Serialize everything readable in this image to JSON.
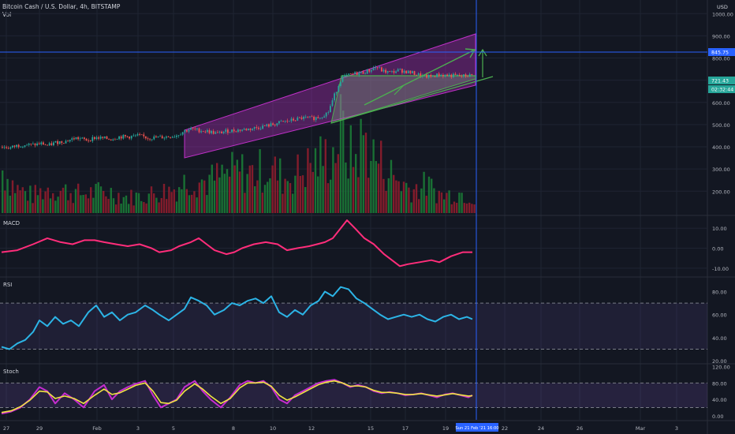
{
  "header": {
    "title": "Bitcoin Cash / U.S. Dollar, 4h, BITSTAMP",
    "volume_label": "Vol",
    "currency": "USD"
  },
  "price_axis": {
    "ticks": [
      "1000.00",
      "900.00",
      "800.00",
      "700.00",
      "600.00",
      "500.00",
      "400.00",
      "300.00",
      "200.00"
    ],
    "badges": [
      {
        "text": "845.75",
        "color": "#2962ff"
      },
      {
        "text": "721.43",
        "color": "#26a69a"
      },
      {
        "text": "02:32:44",
        "color": "#26a69a"
      }
    ]
  },
  "x_axis": {
    "ticks": [
      "27",
      "29",
      "Feb",
      "3",
      "5",
      "8",
      "10",
      "12",
      "15",
      "17",
      "19",
      "22",
      "24",
      "26",
      "Mar",
      "3"
    ],
    "crosshair_badge": "Sun 21 Feb '21  16:00"
  },
  "panes": {
    "macd": {
      "label": "MACD",
      "ticks": [
        "10.00",
        "0.00",
        "-10.00"
      ]
    },
    "rsi": {
      "label": "RSI",
      "ticks": [
        "80.00",
        "60.00",
        "40.00",
        "20.00"
      ]
    },
    "stoch": {
      "label": "Stoch",
      "ticks": [
        "120.00",
        "80.00",
        "40.00",
        "0.00"
      ]
    }
  },
  "colors": {
    "background": "#131722",
    "grid": "#1f2433",
    "up": "#26a69a",
    "down": "#ef5350",
    "vol_up": "#1b7a36",
    "vol_down": "#8f1d2c",
    "channel": "#c030c8",
    "wedge": "#4caf50",
    "crosshair": "#2962ff",
    "macd": "#ff2d7a",
    "rsi": "#2cb4e6",
    "stoch_k": "#c62dcf",
    "stoch_d": "#f0e442"
  },
  "chart_data": {
    "type": "line",
    "title": "Bitcoin Cash / U.S. Dollar, 4h, BITSTAMP",
    "price_range": [
      130,
      1040
    ],
    "price_path": [
      [
        0,
        400
      ],
      [
        12,
        395
      ],
      [
        20,
        405
      ],
      [
        30,
        410
      ],
      [
        40,
        408
      ],
      [
        52,
        415
      ],
      [
        60,
        405
      ],
      [
        70,
        420
      ],
      [
        82,
        425
      ],
      [
        95,
        440
      ],
      [
        110,
        430
      ],
      [
        120,
        442
      ],
      [
        130,
        438
      ],
      [
        140,
        435
      ],
      [
        150,
        445
      ],
      [
        162,
        445
      ],
      [
        175,
        450
      ],
      [
        187,
        440
      ],
      [
        200,
        442
      ],
      [
        210,
        445
      ],
      [
        222,
        450
      ],
      [
        232,
        470
      ],
      [
        240,
        480
      ],
      [
        250,
        475
      ],
      [
        262,
        470
      ],
      [
        275,
        460
      ],
      [
        285,
        470
      ],
      [
        300,
        475
      ],
      [
        315,
        480
      ],
      [
        330,
        490
      ],
      [
        345,
        500
      ],
      [
        355,
        510
      ],
      [
        370,
        520
      ],
      [
        382,
        530
      ],
      [
        395,
        528
      ],
      [
        405,
        535
      ],
      [
        415,
        555
      ],
      [
        424,
        640
      ],
      [
        432,
        710
      ],
      [
        440,
        720
      ],
      [
        450,
        730
      ],
      [
        460,
        735
      ],
      [
        468,
        745
      ],
      [
        476,
        760
      ],
      [
        485,
        740
      ],
      [
        495,
        735
      ],
      [
        505,
        745
      ],
      [
        515,
        738
      ],
      [
        525,
        730
      ],
      [
        535,
        718
      ],
      [
        545,
        715
      ],
      [
        555,
        725
      ],
      [
        565,
        722
      ],
      [
        575,
        720
      ],
      [
        585,
        718
      ],
      [
        595,
        722
      ],
      [
        600,
        721
      ]
    ],
    "volume_path": [
      [
        0,
        260
      ],
      [
        20,
        200
      ],
      [
        40,
        180
      ],
      [
        60,
        200
      ],
      [
        80,
        195
      ],
      [
        100,
        185
      ],
      [
        120,
        190
      ],
      [
        140,
        190
      ],
      [
        160,
        175
      ],
      [
        180,
        180
      ],
      [
        200,
        190
      ],
      [
        220,
        200
      ],
      [
        240,
        230
      ],
      [
        260,
        220
      ],
      [
        280,
        235
      ],
      [
        300,
        250
      ],
      [
        320,
        245
      ],
      [
        340,
        260
      ],
      [
        360,
        230
      ],
      [
        380,
        250
      ],
      [
        400,
        280
      ],
      [
        420,
        295
      ],
      [
        432,
        370
      ],
      [
        440,
        300
      ],
      [
        450,
        290
      ],
      [
        460,
        350
      ],
      [
        470,
        300
      ],
      [
        480,
        280
      ],
      [
        500,
        230
      ],
      [
        520,
        200
      ],
      [
        540,
        210
      ],
      [
        560,
        180
      ],
      [
        580,
        190
      ],
      [
        600,
        175
      ]
    ],
    "macd_path": [
      [
        0,
        -2
      ],
      [
        20,
        -1
      ],
      [
        40,
        2
      ],
      [
        58,
        5
      ],
      [
        75,
        3
      ],
      [
        90,
        2
      ],
      [
        105,
        4
      ],
      [
        118,
        4
      ],
      [
        130,
        3
      ],
      [
        145,
        2
      ],
      [
        160,
        1
      ],
      [
        175,
        2
      ],
      [
        190,
        0
      ],
      [
        200,
        -2
      ],
      [
        215,
        -1
      ],
      [
        225,
        1
      ],
      [
        240,
        3
      ],
      [
        250,
        5
      ],
      [
        260,
        2
      ],
      [
        270,
        -1
      ],
      [
        285,
        -3
      ],
      [
        295,
        -2
      ],
      [
        305,
        0
      ],
      [
        320,
        2
      ],
      [
        335,
        3
      ],
      [
        350,
        2
      ],
      [
        362,
        -1
      ],
      [
        375,
        0
      ],
      [
        390,
        1
      ],
      [
        400,
        2
      ],
      [
        410,
        3
      ],
      [
        420,
        5
      ],
      [
        430,
        10
      ],
      [
        438,
        14
      ],
      [
        448,
        10
      ],
      [
        460,
        5
      ],
      [
        472,
        2
      ],
      [
        485,
        -3
      ],
      [
        495,
        -6
      ],
      [
        505,
        -9
      ],
      [
        515,
        -8
      ],
      [
        530,
        -7
      ],
      [
        545,
        -6
      ],
      [
        555,
        -7
      ],
      [
        570,
        -4
      ],
      [
        585,
        -2
      ],
      [
        597,
        -2
      ]
    ],
    "macd_range": [
      -14,
      16
    ],
    "rsi_path": [
      [
        0,
        32
      ],
      [
        10,
        30
      ],
      [
        20,
        35
      ],
      [
        30,
        38
      ],
      [
        40,
        45
      ],
      [
        48,
        55
      ],
      [
        58,
        50
      ],
      [
        68,
        58
      ],
      [
        78,
        52
      ],
      [
        88,
        55
      ],
      [
        98,
        50
      ],
      [
        110,
        62
      ],
      [
        120,
        68
      ],
      [
        130,
        58
      ],
      [
        140,
        62
      ],
      [
        150,
        55
      ],
      [
        160,
        60
      ],
      [
        170,
        62
      ],
      [
        182,
        68
      ],
      [
        192,
        64
      ],
      [
        200,
        60
      ],
      [
        212,
        55
      ],
      [
        222,
        60
      ],
      [
        232,
        65
      ],
      [
        240,
        75
      ],
      [
        250,
        72
      ],
      [
        260,
        68
      ],
      [
        270,
        60
      ],
      [
        282,
        64
      ],
      [
        292,
        70
      ],
      [
        302,
        68
      ],
      [
        312,
        72
      ],
      [
        322,
        74
      ],
      [
        332,
        70
      ],
      [
        342,
        76
      ],
      [
        352,
        62
      ],
      [
        362,
        58
      ],
      [
        372,
        64
      ],
      [
        382,
        60
      ],
      [
        392,
        68
      ],
      [
        402,
        72
      ],
      [
        410,
        80
      ],
      [
        420,
        76
      ],
      [
        430,
        84
      ],
      [
        440,
        82
      ],
      [
        450,
        74
      ],
      [
        460,
        70
      ],
      [
        470,
        65
      ],
      [
        480,
        60
      ],
      [
        490,
        56
      ],
      [
        500,
        58
      ],
      [
        510,
        60
      ],
      [
        520,
        58
      ],
      [
        530,
        60
      ],
      [
        540,
        56
      ],
      [
        550,
        54
      ],
      [
        560,
        58
      ],
      [
        570,
        60
      ],
      [
        580,
        56
      ],
      [
        590,
        58
      ],
      [
        597,
        56
      ]
    ],
    "rsi_range": [
      18,
      92
    ],
    "stoch_k_path": [
      [
        0,
        5
      ],
      [
        12,
        10
      ],
      [
        24,
        20
      ],
      [
        36,
        40
      ],
      [
        48,
        70
      ],
      [
        58,
        60
      ],
      [
        68,
        30
      ],
      [
        80,
        55
      ],
      [
        92,
        40
      ],
      [
        104,
        20
      ],
      [
        118,
        60
      ],
      [
        130,
        75
      ],
      [
        140,
        40
      ],
      [
        150,
        60
      ],
      [
        160,
        70
      ],
      [
        170,
        78
      ],
      [
        182,
        85
      ],
      [
        192,
        50
      ],
      [
        202,
        20
      ],
      [
        212,
        30
      ],
      [
        222,
        40
      ],
      [
        232,
        70
      ],
      [
        245,
        85
      ],
      [
        255,
        60
      ],
      [
        265,
        40
      ],
      [
        278,
        20
      ],
      [
        290,
        45
      ],
      [
        302,
        75
      ],
      [
        312,
        85
      ],
      [
        322,
        80
      ],
      [
        332,
        85
      ],
      [
        342,
        70
      ],
      [
        352,
        40
      ],
      [
        362,
        30
      ],
      [
        372,
        50
      ],
      [
        382,
        60
      ],
      [
        392,
        70
      ],
      [
        402,
        80
      ],
      [
        412,
        85
      ],
      [
        422,
        88
      ],
      [
        432,
        80
      ],
      [
        442,
        70
      ],
      [
        452,
        75
      ],
      [
        462,
        70
      ],
      [
        472,
        60
      ],
      [
        482,
        55
      ],
      [
        492,
        58
      ],
      [
        502,
        55
      ],
      [
        512,
        50
      ],
      [
        522,
        52
      ],
      [
        532,
        55
      ],
      [
        542,
        50
      ],
      [
        552,
        45
      ],
      [
        562,
        52
      ],
      [
        572,
        55
      ],
      [
        582,
        50
      ],
      [
        592,
        45
      ],
      [
        597,
        50
      ]
    ],
    "stoch_d_path": [
      [
        0,
        8
      ],
      [
        12,
        12
      ],
      [
        24,
        22
      ],
      [
        36,
        38
      ],
      [
        48,
        60
      ],
      [
        58,
        58
      ],
      [
        68,
        42
      ],
      [
        80,
        48
      ],
      [
        92,
        42
      ],
      [
        104,
        30
      ],
      [
        118,
        50
      ],
      [
        130,
        65
      ],
      [
        140,
        52
      ],
      [
        150,
        56
      ],
      [
        160,
        65
      ],
      [
        170,
        74
      ],
      [
        182,
        80
      ],
      [
        192,
        60
      ],
      [
        202,
        32
      ],
      [
        212,
        30
      ],
      [
        222,
        38
      ],
      [
        232,
        60
      ],
      [
        245,
        78
      ],
      [
        255,
        65
      ],
      [
        265,
        48
      ],
      [
        278,
        30
      ],
      [
        290,
        42
      ],
      [
        302,
        68
      ],
      [
        312,
        80
      ],
      [
        322,
        80
      ],
      [
        332,
        82
      ],
      [
        342,
        72
      ],
      [
        352,
        50
      ],
      [
        362,
        38
      ],
      [
        372,
        46
      ],
      [
        382,
        56
      ],
      [
        392,
        66
      ],
      [
        402,
        76
      ],
      [
        412,
        82
      ],
      [
        422,
        85
      ],
      [
        432,
        80
      ],
      [
        442,
        72
      ],
      [
        452,
        73
      ],
      [
        462,
        70
      ],
      [
        472,
        62
      ],
      [
        482,
        57
      ],
      [
        492,
        57
      ],
      [
        502,
        55
      ],
      [
        512,
        52
      ],
      [
        522,
        52
      ],
      [
        532,
        54
      ],
      [
        542,
        51
      ],
      [
        552,
        48
      ],
      [
        562,
        51
      ],
      [
        572,
        54
      ],
      [
        582,
        51
      ],
      [
        592,
        48
      ],
      [
        597,
        49
      ]
    ],
    "stoch_range": [
      -10,
      125
    ]
  }
}
